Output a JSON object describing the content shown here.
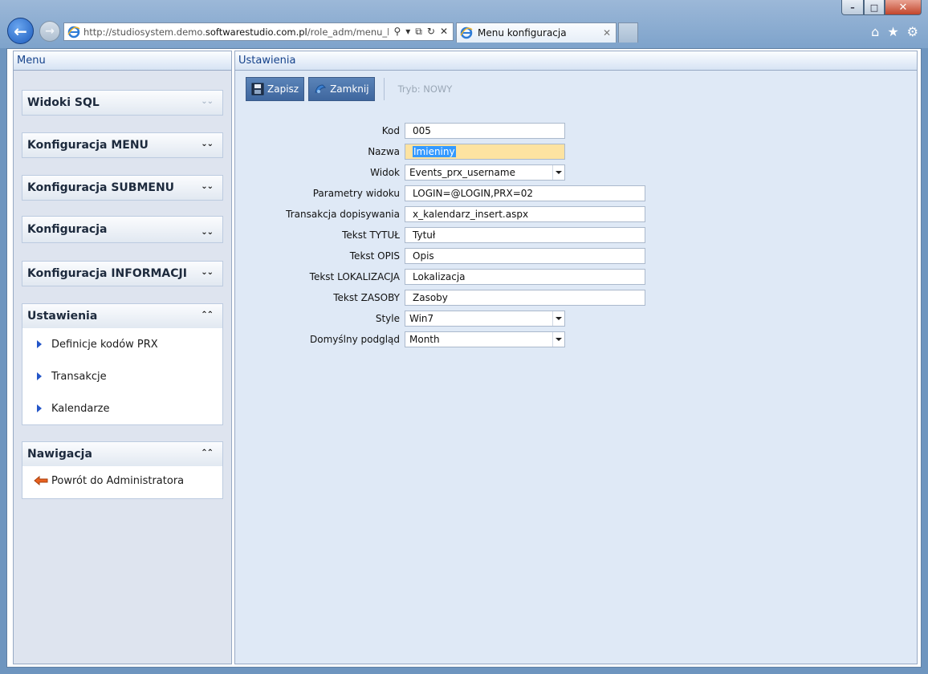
{
  "browser": {
    "url_prefix": "http://studiosystem.demo.",
    "url_domain": "softwarestudio.com.pl",
    "url_suffix": "/role_adm/menu_kon",
    "tab_title": "Menu konfiguracja"
  },
  "left_panel": {
    "title": "Menu",
    "sections": [
      {
        "title": "Widoki SQL"
      },
      {
        "title": "Konfiguracja MENU"
      },
      {
        "title": "Konfiguracja SUBMENU"
      },
      {
        "title": "Konfiguracja"
      },
      {
        "title": "Konfiguracja INFORMACJI"
      },
      {
        "title": "Ustawienia",
        "items": [
          "Definicje kodów PRX",
          "Transakcje",
          "Kalendarze"
        ]
      },
      {
        "title": "Nawigacja",
        "items": [
          "Powrót do Administratora"
        ]
      }
    ]
  },
  "right_panel": {
    "title": "Ustawienia",
    "toolbar": {
      "save_label": "Zapisz",
      "close_label": "Zamknij",
      "mode_label": "Tryb: NOWY"
    },
    "form": {
      "kod": {
        "label": "Kod",
        "value": "005"
      },
      "nazwa": {
        "label": "Nazwa",
        "value": "Imieniny"
      },
      "widok": {
        "label": "Widok",
        "value": "Events_prx_username"
      },
      "parametry": {
        "label": "Parametry widoku",
        "value": "LOGIN=@LOGIN,PRX=02"
      },
      "transakcja": {
        "label": "Transakcja dopisywania",
        "value": "x_kalendarz_insert.aspx"
      },
      "tytul": {
        "label": "Tekst TYTUŁ",
        "value": "Tytuł"
      },
      "opis": {
        "label": "Tekst OPIS",
        "value": "Opis"
      },
      "lokalizacja": {
        "label": "Tekst LOKALIZACJA",
        "value": "Lokalizacja"
      },
      "zasoby": {
        "label": "Tekst ZASOBY",
        "value": "Zasoby"
      },
      "style": {
        "label": "Style",
        "value": "Win7"
      },
      "podglad": {
        "label": "Domyślny podgląd",
        "value": "Month"
      }
    }
  }
}
